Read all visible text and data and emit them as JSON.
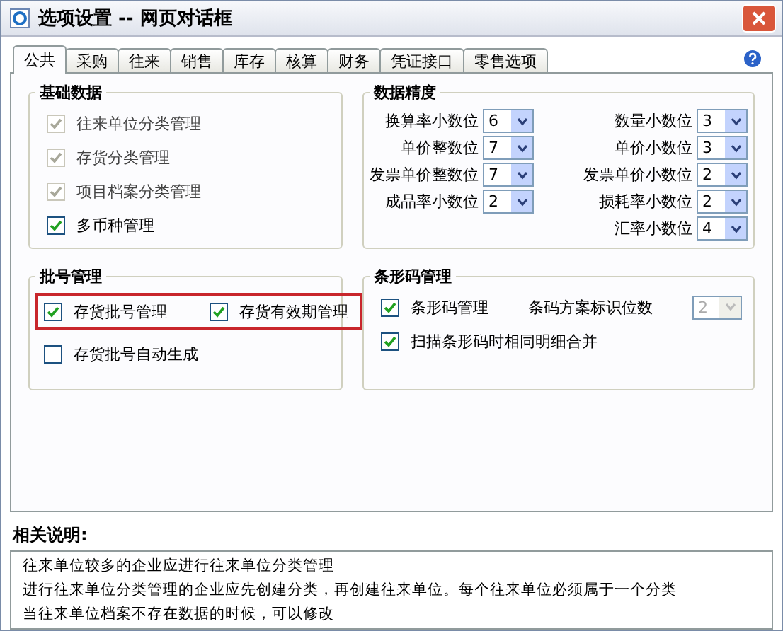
{
  "window": {
    "title": "选项设置 -- 网页对话框"
  },
  "tabs": [
    {
      "label": "公共",
      "selected": true
    },
    {
      "label": "采购",
      "selected": false
    },
    {
      "label": "往来",
      "selected": false
    },
    {
      "label": "销售",
      "selected": false
    },
    {
      "label": "库存",
      "selected": false
    },
    {
      "label": "核算",
      "selected": false
    },
    {
      "label": "财务",
      "selected": false
    },
    {
      "label": "凭证接口",
      "selected": false
    },
    {
      "label": "零售选项",
      "selected": false
    }
  ],
  "basic_data": {
    "title": "基础数据",
    "items": [
      {
        "label": "往来单位分类管理",
        "checked": true,
        "disabled": true
      },
      {
        "label": "存货分类管理",
        "checked": true,
        "disabled": true
      },
      {
        "label": "项目档案分类管理",
        "checked": true,
        "disabled": true
      },
      {
        "label": "多币种管理",
        "checked": true,
        "disabled": false
      }
    ]
  },
  "precision": {
    "title": "数据精度",
    "rows": [
      [
        {
          "label": "换算率小数位",
          "value": "6"
        },
        {
          "label": "数量小数位",
          "value": "3"
        }
      ],
      [
        {
          "label": "单价整数位",
          "value": "7"
        },
        {
          "label": "单价小数位",
          "value": "3"
        }
      ],
      [
        {
          "label": "发票单价整数位",
          "value": "7"
        },
        {
          "label": "发票单价小数位",
          "value": "2"
        }
      ],
      [
        {
          "label": "成品率小数位",
          "value": "2"
        },
        {
          "label": "损耗率小数位",
          "value": "2"
        }
      ],
      [
        "",
        {
          "label": "汇率小数位",
          "value": "4"
        }
      ]
    ]
  },
  "batch": {
    "title": "批号管理",
    "rows": [
      {
        "highlighted": true,
        "items": [
          {
            "label": "存货批号管理",
            "checked": true
          },
          {
            "label": "存货有效期管理",
            "checked": true
          }
        ]
      },
      {
        "highlighted": false,
        "items": [
          {
            "label": "存货批号自动生成",
            "checked": false
          }
        ]
      }
    ]
  },
  "barcode": {
    "title": "条形码管理",
    "items": [
      {
        "label": "条形码管理",
        "checked": true,
        "setting": {
          "label": "条码方案标识位数",
          "value": "2",
          "disabled": true
        }
      },
      {
        "label": "扫描条形码时相同明细合并",
        "checked": true
      }
    ]
  },
  "notes": {
    "title": "相关说明:",
    "lines": [
      "往来单位较多的企业应进行往来单位分类管理",
      "进行往来单位分类管理的企业应先创建分类，再创建往来单位。每个往来单位必须属于一个分类",
      "当往来单位档案不存在数据的时候，可以修改"
    ]
  }
}
